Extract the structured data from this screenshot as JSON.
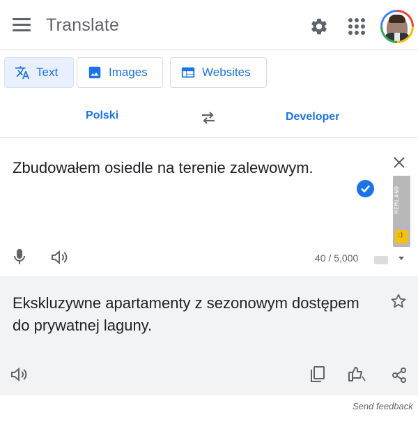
{
  "header": {
    "title": "Translate",
    "menu_icon": "menu-icon",
    "settings_icon": "gear-icon",
    "apps_icon": "apps-grid-icon"
  },
  "modes": [
    {
      "label": "Text",
      "icon": "translate-icon",
      "selected": true
    },
    {
      "label": "Images",
      "icon": "image-icon",
      "selected": false
    },
    {
      "label": "Websites",
      "icon": "web-icon",
      "selected": false
    }
  ],
  "languages": {
    "source": "Polski",
    "target": "Developer"
  },
  "source": {
    "text": "Zbudowałem osiedle na terenie zalewowym.",
    "char_count": "40 / 5,000"
  },
  "result": {
    "text": "Ekskluzywne apartamenty z sezonowym dostępem do prywatnej laguny."
  },
  "footer": {
    "send_feedback": "Send feedback"
  },
  "watermark": {
    "text": "MEMLAND"
  },
  "colors": {
    "accent": "#1a73e8",
    "result_bg": "#f1f3f4",
    "selected_mode_bg": "#e8f0fe"
  }
}
